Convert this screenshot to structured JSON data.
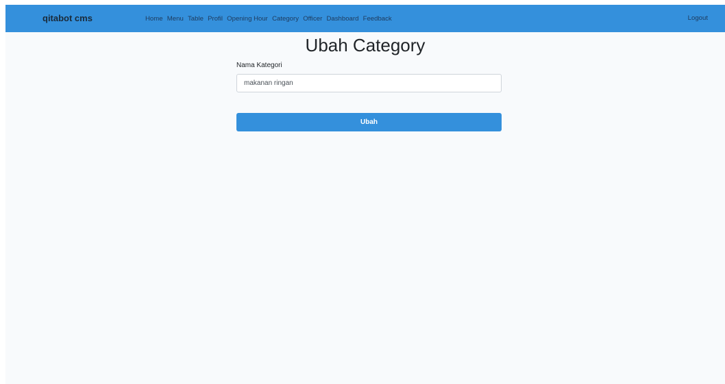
{
  "navbar": {
    "brand": "qitabot cms",
    "links": [
      "Home",
      "Menu",
      "Table",
      "Profil",
      "Opening Hour",
      "Category",
      "Officer",
      "Dashboard",
      "Feedback"
    ],
    "logout": "Logout",
    "background_color": "#3490dc"
  },
  "page": {
    "title": "Ubah Category"
  },
  "form": {
    "category_name_label": "Nama Kategori",
    "category_name_value": "makanan ringan",
    "submit_label": "Ubah",
    "accent_color": "#3490dc"
  }
}
